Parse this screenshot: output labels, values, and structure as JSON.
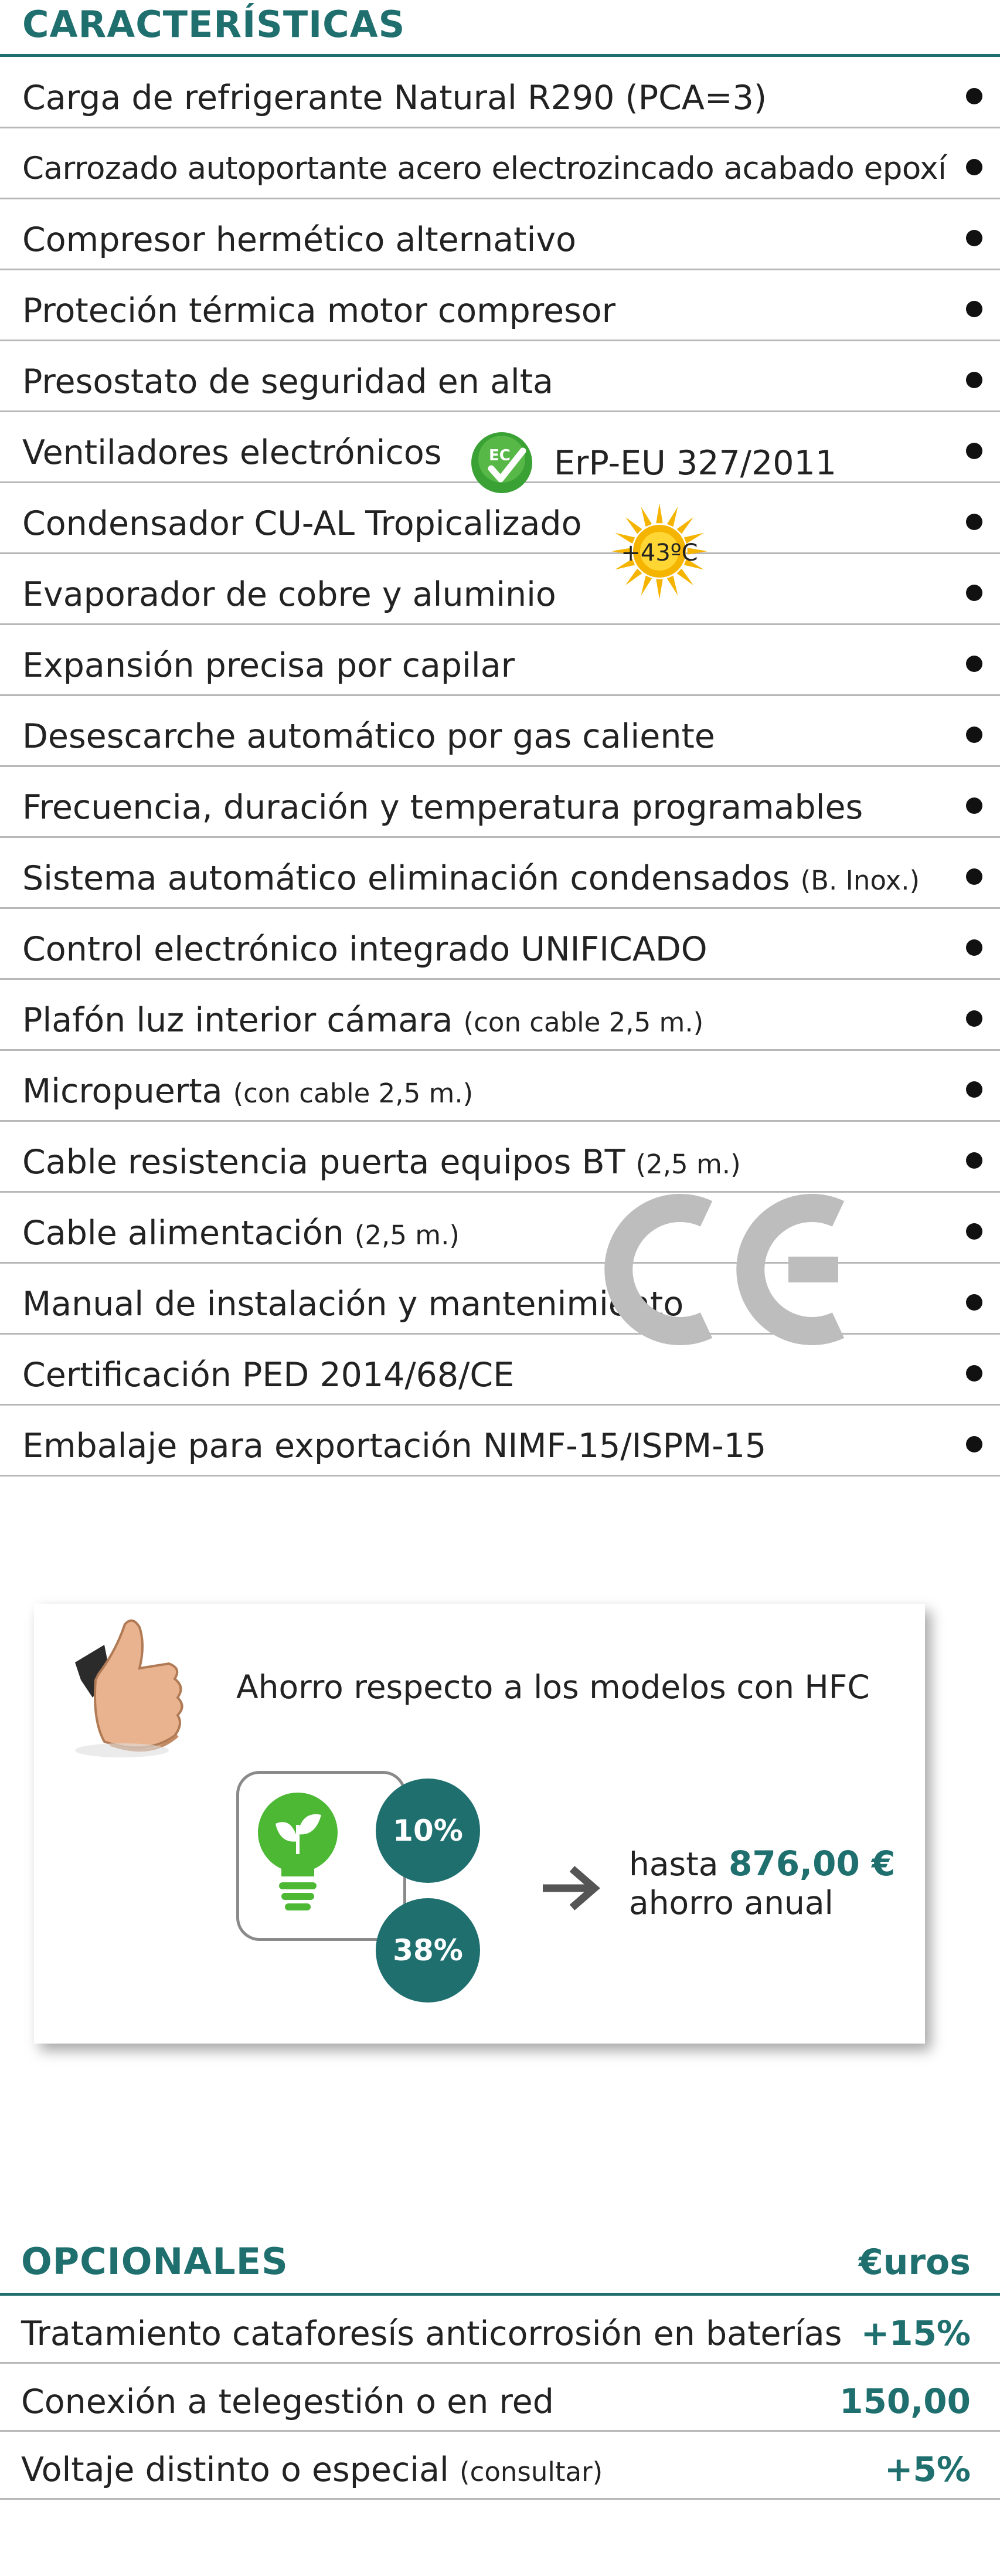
{
  "caracteristicas": {
    "title": "CARACTERÍSTICAS",
    "items": [
      {
        "text": "Carga de refrigerante Natural R290  (PCA=3)",
        "note": ""
      },
      {
        "text": "Carrozado autoportante acero electrozincado acabado epoxí",
        "note": ""
      },
      {
        "text": "Compresor hermético alternativo",
        "note": ""
      },
      {
        "text": "Proteción térmica motor compresor",
        "note": ""
      },
      {
        "text": "Presostato de seguridad en alta",
        "note": ""
      },
      {
        "text": "Ventiladores electrónicos",
        "note": ""
      },
      {
        "text": "Condensador CU-AL Tropicalizado",
        "note": ""
      },
      {
        "text": "Evaporador de cobre y aluminio",
        "note": ""
      },
      {
        "text": "Expansión precisa por capilar",
        "note": ""
      },
      {
        "text": "Desescarche automático por gas caliente",
        "note": ""
      },
      {
        "text": "Frecuencia, duración y temperatura programables",
        "note": ""
      },
      {
        "text": "Sistema automático eliminación condensados",
        "note": "(B. Inox.)"
      },
      {
        "text": "Control electrónico integrado UNIFICADO",
        "note": ""
      },
      {
        "text": "Plafón luz interior cámara",
        "note": "(con cable 2,5 m.)"
      },
      {
        "text": "Micropuerta",
        "note": "(con cable 2,5 m.)"
      },
      {
        "text": "Cable resistencia puerta equipos BT",
        "note": "(2,5 m.)"
      },
      {
        "text": "Cable alimentación",
        "note": "(2,5 m.)"
      },
      {
        "text": "Manual de instalación y mantenimiento",
        "note": ""
      },
      {
        "text": "Certificación PED 2014/68/CE",
        "note": ""
      },
      {
        "text": "Embalaje para exportación NIMF-15/ISPM-15",
        "note": ""
      }
    ],
    "erp_text": "ErP-EU 327/2011",
    "ec_label": "EC",
    "temp_label": "+43ºC"
  },
  "savings": {
    "heading": "Ahorro respecto a los modelos con HFC",
    "pct_1": "10%",
    "pct_2": "38%",
    "prefix": "hasta",
    "amount": "876,00 €",
    "suffix": "ahorro anual"
  },
  "opcionales": {
    "title": "OPCIONALES",
    "currency_header": "€uros",
    "items": [
      {
        "text": "Tratamiento cataforesís anticorrosión en baterías",
        "note": "",
        "price": "+15%"
      },
      {
        "text": "Conexión a telegestión o en red",
        "note": "",
        "price": "150,00"
      },
      {
        "text": "Voltaje distinto o especial",
        "note": "(consultar)",
        "price": "+5%"
      }
    ]
  },
  "colors": {
    "accent": "#1f6f6f",
    "row_border": "#b8b8b8",
    "bullet": "#111111",
    "ec_green": "#3aa235",
    "sun_yellow": "#f5b400"
  },
  "icons": [
    "ec-fan-icon",
    "sun-icon",
    "ce-mark-icon",
    "thumbs-up-icon",
    "eco-bulb-icon",
    "arrow-right-icon"
  ]
}
